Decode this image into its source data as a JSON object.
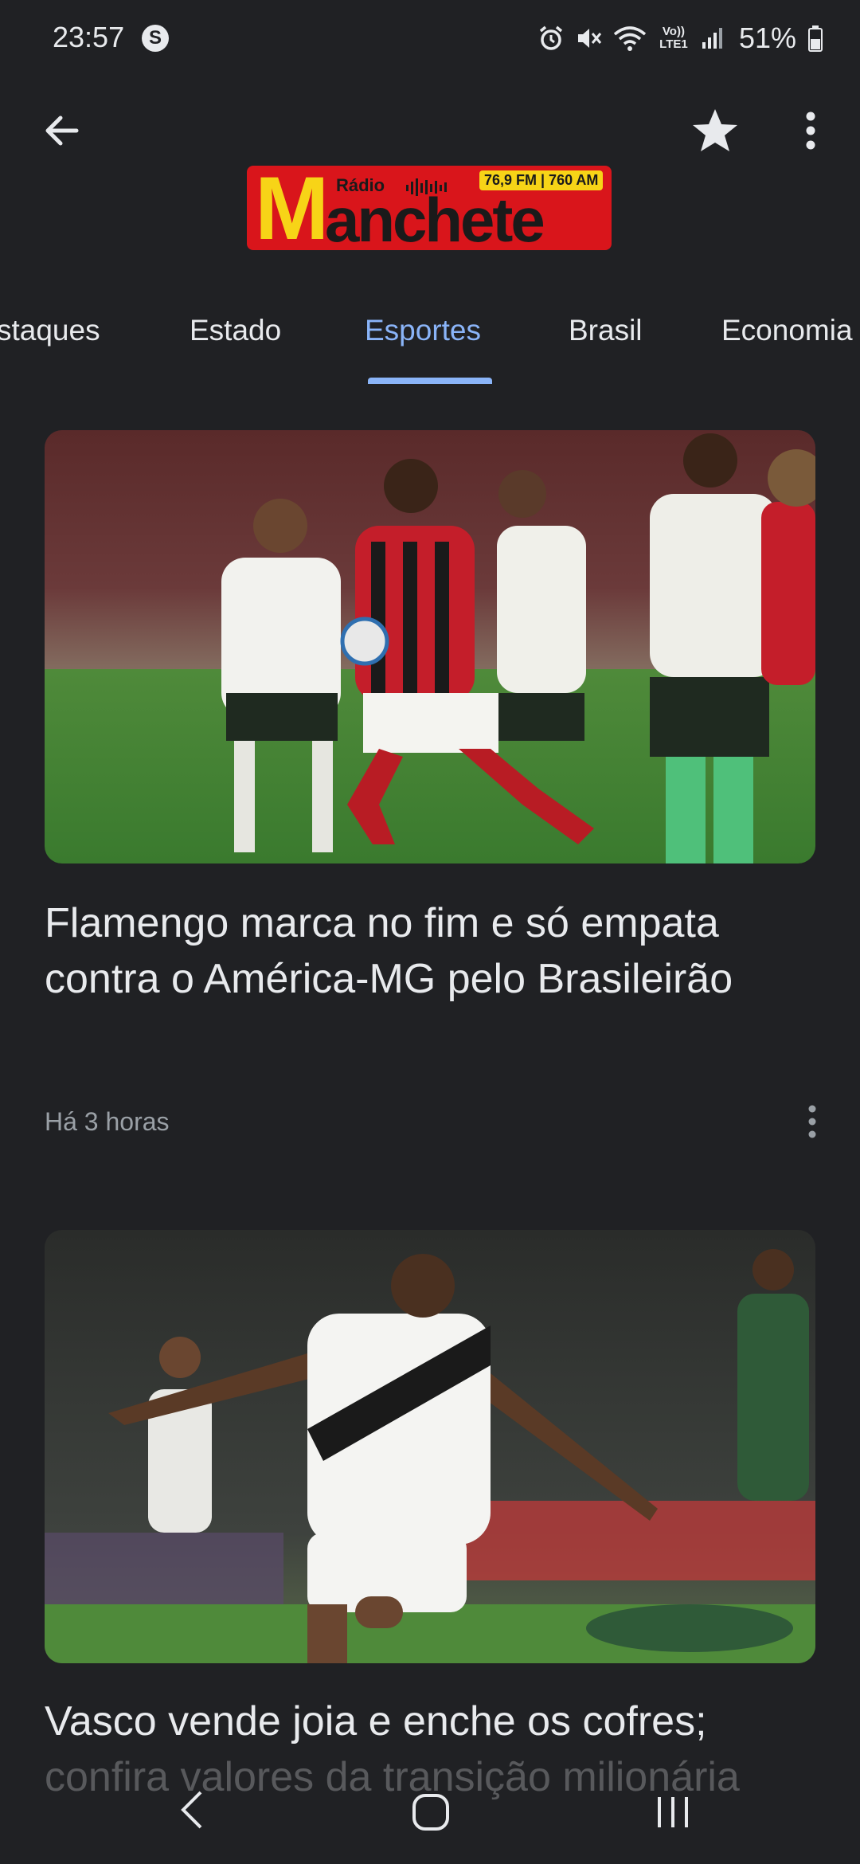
{
  "status_bar": {
    "time": "23:57",
    "s_icon": "S",
    "volte": "Vo)) LTE1",
    "battery": "51%",
    "icons": [
      "alarm-icon",
      "mute-icon",
      "wifi-icon",
      "volte-icon",
      "signal-icon",
      "battery-icon"
    ]
  },
  "top_bar": {
    "icons": [
      "back-arrow-icon",
      "star-icon",
      "more-vert-icon"
    ]
  },
  "logo": {
    "radio": "Rádio",
    "m": "M",
    "word": "anchete",
    "frequency": "76,9 FM | 760 AM",
    "colors": {
      "background": "#d9151b",
      "accent": "#f7d417"
    }
  },
  "tabs": {
    "items": [
      {
        "label": "staques"
      },
      {
        "label": "Estado"
      },
      {
        "label": "Esportes"
      },
      {
        "label": "Brasil"
      },
      {
        "label": "Economia"
      }
    ],
    "active": "Esportes",
    "active_color": "#8ab4f8"
  },
  "articles": [
    {
      "title": "Flamengo marca no fim e só empata contra o América-MG pelo Brasileirão",
      "time": "Há 3 horas",
      "image_description": "football-match-photo"
    },
    {
      "title": "Vasco vende joia e enche os cofres; confira valores da transição milionária",
      "image_description": "football-player-celebration-photo"
    }
  ],
  "nav_bar": {
    "icons": [
      "nav-back-icon",
      "nav-home-icon",
      "nav-recents-icon"
    ]
  }
}
